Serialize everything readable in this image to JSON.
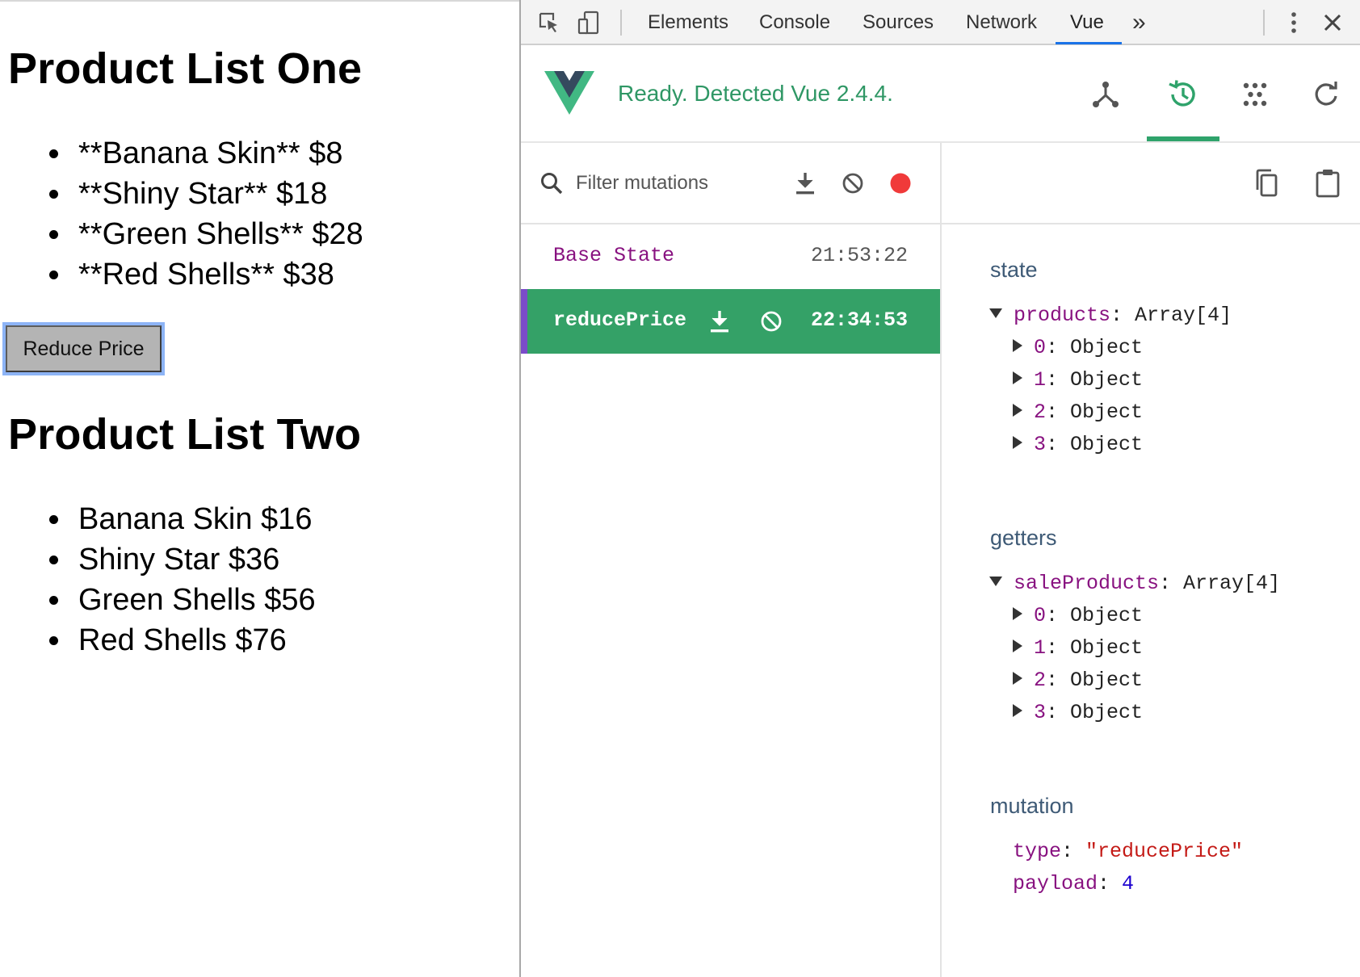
{
  "page": {
    "list_one": {
      "heading": "Product List One",
      "items": [
        "**Banana Skin** $8",
        "**Shiny Star** $18",
        "**Green Shells** $28",
        "**Red Shells** $38"
      ]
    },
    "reduce_button": "Reduce Price",
    "list_two": {
      "heading": "Product List Two",
      "items": [
        "Banana Skin $16",
        "Shiny Star $36",
        "Green Shells $56",
        "Red Shells $76"
      ]
    }
  },
  "devtools": {
    "tabs": [
      "Elements",
      "Console",
      "Sources",
      "Network",
      "Vue"
    ],
    "active_tab": "Vue",
    "more_tabs": "»",
    "icons": {
      "inspect": "inspect-element-icon",
      "device": "device-toolbar-icon",
      "menu": "kebab-menu-icon",
      "close": "close-icon"
    },
    "vue": {
      "status": "Ready. Detected Vue 2.4.4.",
      "logo_colors": {
        "outer": "#41b883",
        "inner": "#35495e"
      },
      "nav_icons": [
        "components-icon",
        "vuex-history-icon",
        "events-icon",
        "refresh-icon"
      ],
      "accent": "#2fa36b"
    },
    "mutations": {
      "filter_placeholder": "Filter mutations",
      "toolbar_icons": [
        "commit-all-icon",
        "revert-all-icon",
        "record-icon"
      ],
      "record_color": "#f03a3a",
      "rows": [
        {
          "name": "Base State",
          "time": "21:53:22",
          "active": false
        },
        {
          "name": "reducePrice",
          "time": "22:34:53",
          "active": true
        }
      ]
    },
    "inspector": {
      "toolbar_icons": [
        "copy-icon",
        "paste-icon"
      ],
      "state": {
        "title": "state",
        "root_key": "products",
        "root_value": "Array[4]",
        "children": [
          {
            "key": "0",
            "value": "Object"
          },
          {
            "key": "1",
            "value": "Object"
          },
          {
            "key": "2",
            "value": "Object"
          },
          {
            "key": "3",
            "value": "Object"
          }
        ]
      },
      "getters": {
        "title": "getters",
        "root_key": "saleProducts",
        "root_value": "Array[4]",
        "children": [
          {
            "key": "0",
            "value": "Object"
          },
          {
            "key": "1",
            "value": "Object"
          },
          {
            "key": "2",
            "value": "Object"
          },
          {
            "key": "3",
            "value": "Object"
          }
        ]
      },
      "mutation": {
        "title": "mutation",
        "type_key": "type",
        "type_value": "\"reducePrice\"",
        "payload_key": "payload",
        "payload_value": "4"
      }
    }
  }
}
